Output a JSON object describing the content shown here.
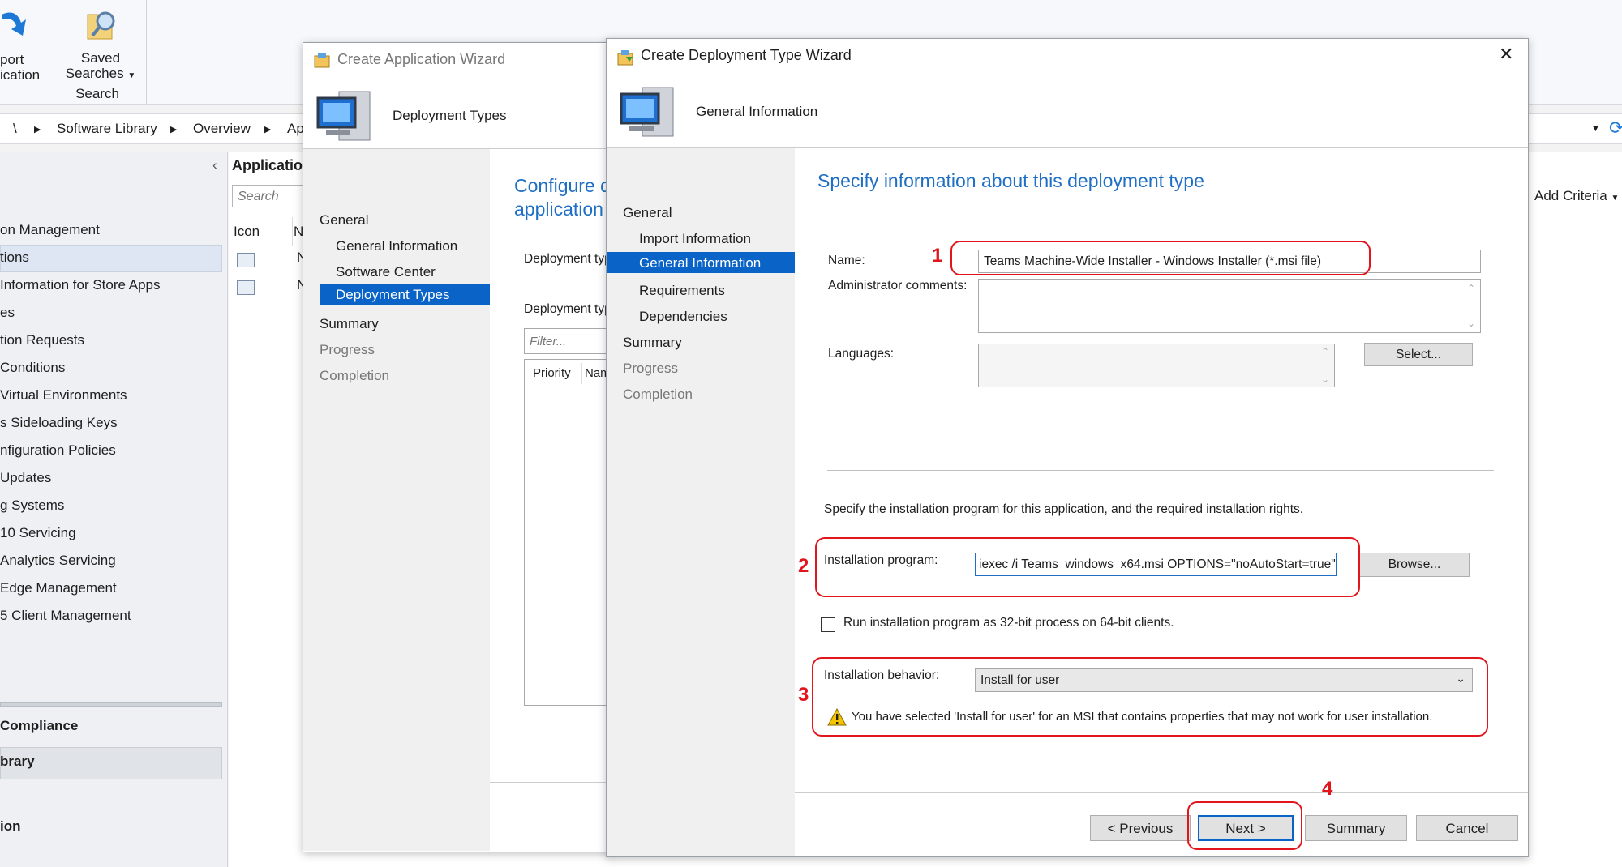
{
  "ribbon": {
    "import_label_1": "port",
    "import_label_2": "ication",
    "saved_label_1": "Saved",
    "saved_label_2": "Searches",
    "search_group": "Search"
  },
  "address_bar": {
    "root": "\\",
    "crumb1": "Software Library",
    "crumb2": "Overview",
    "crumb3": "Ap"
  },
  "nav": {
    "collapse": "‹",
    "items": [
      "on Management",
      "tions",
      "Information for Store Apps",
      "es",
      "tion Requests",
      "Conditions",
      "Virtual Environments",
      "s Sideloading Keys",
      "nfiguration Policies",
      "Updates",
      "g Systems",
      "10 Servicing",
      "Analytics Servicing",
      "Edge Management",
      "5 Client Management"
    ],
    "compliance": "Compliance",
    "library": "brary",
    "bottom": "ion"
  },
  "list_pane": {
    "title": "Application",
    "search_placeholder": "Search",
    "col_icon": "Icon",
    "col_n": "N",
    "add_criteria": "Add Criteria"
  },
  "app_wizard": {
    "title": "Create Application Wizard",
    "header": "Deployment Types",
    "steps": [
      "General",
      "General Information",
      "Software Center",
      "Deployment Types",
      "Summary",
      "Progress",
      "Completion"
    ],
    "content_title_1": "Configure d",
    "content_title_2": "application",
    "label_dt1": "Deployment typ",
    "label_dt2": "Deployment typ",
    "filter_placeholder": "Filter...",
    "col_priority": "Priority",
    "col_name": "Nam"
  },
  "dt_wizard": {
    "title": "Create Deployment Type Wizard",
    "close": "✕",
    "header": "General Information",
    "steps": [
      "General",
      "Import Information",
      "General Information",
      "Requirements",
      "Dependencies",
      "Summary",
      "Progress",
      "Completion"
    ],
    "content_title": "Specify information about this deployment type",
    "name_label": "Name:",
    "name_value": "Teams Machine-Wide Installer - Windows Installer (*.msi file)",
    "admin_comments_label": "Administrator comments:",
    "languages_label": "Languages:",
    "select_button": "Select...",
    "install_info": "Specify the installation program for this application, and the required installation rights.",
    "install_program_label": "Installation program:",
    "install_program_value": "iexec /i Teams_windows_x64.msi OPTIONS=\"noAutoStart=true\"",
    "browse_button": "Browse...",
    "run32_label": "Run installation program as 32-bit process on 64-bit clients.",
    "behavior_label": "Installation behavior:",
    "behavior_value": "Install for user",
    "warning_text": "You have selected 'Install for user' for an MSI that contains properties that may not work for user installation.",
    "prev_button": "< Previous",
    "next_button": "Next >",
    "summary_button": "Summary",
    "cancel_button": "Cancel"
  },
  "annotations": {
    "n1": "1",
    "n2": "2",
    "n3": "3",
    "n4": "4"
  },
  "colors": {
    "accent": "#0a64c8",
    "title_blue": "#1f6fc5",
    "annotation_red": "#e2151c"
  }
}
